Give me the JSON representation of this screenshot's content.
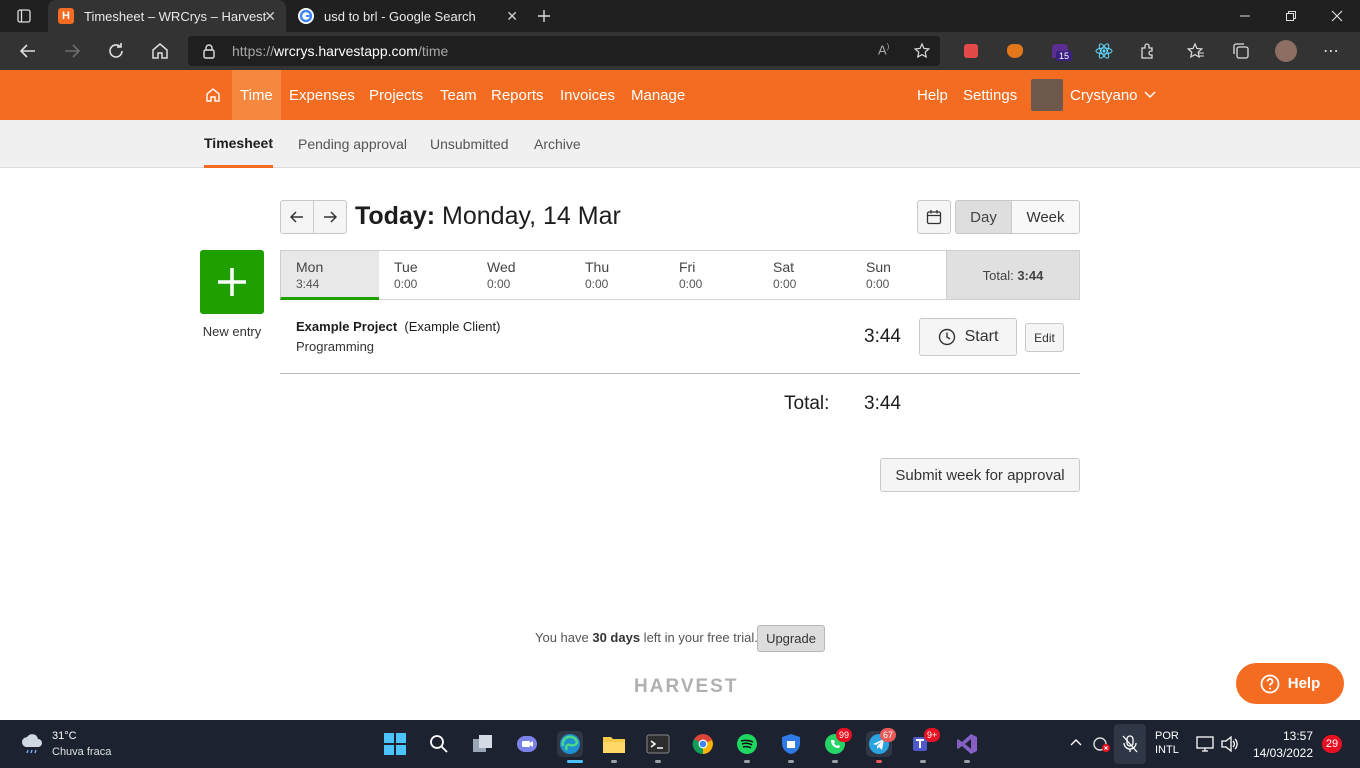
{
  "browser": {
    "tabs": [
      {
        "title": "Timesheet – WRCrys – Harvest",
        "favicon_letter": "H",
        "active": true
      },
      {
        "title": "usd to brl - Google Search",
        "favicon_letter": "G",
        "active": false
      }
    ],
    "url": {
      "scheme": "https://",
      "host": "wrcrys.harvestapp.com",
      "path": "/time"
    },
    "extension_badge": "15"
  },
  "nav": {
    "items": [
      "Time",
      "Expenses",
      "Projects",
      "Team",
      "Reports",
      "Invoices",
      "Manage"
    ],
    "active": "Time",
    "help": "Help",
    "settings": "Settings",
    "user": "Crystyano"
  },
  "subnav": {
    "items": [
      "Timesheet",
      "Pending approval",
      "Unsubmitted",
      "Archive"
    ],
    "active": "Timesheet"
  },
  "header": {
    "today_label": "Today:",
    "date_text": "Monday, 14 Mar"
  },
  "view_toggle": {
    "day": "Day",
    "week": "Week",
    "active": "Day"
  },
  "new_entry": {
    "label": "New entry"
  },
  "days": [
    {
      "name": "Mon",
      "time": "3:44",
      "active": true
    },
    {
      "name": "Tue",
      "time": "0:00"
    },
    {
      "name": "Wed",
      "time": "0:00"
    },
    {
      "name": "Thu",
      "time": "0:00"
    },
    {
      "name": "Fri",
      "time": "0:00"
    },
    {
      "name": "Sat",
      "time": "0:00"
    },
    {
      "name": "Sun",
      "time": "0:00"
    }
  ],
  "week_total": {
    "label": "Total:",
    "value": "3:44"
  },
  "entry": {
    "project": "Example Project",
    "client": "(Example Client)",
    "task": "Programming",
    "duration": "3:44",
    "start_label": "Start",
    "edit_label": "Edit"
  },
  "day_total": {
    "label": "Total:",
    "value": "3:44"
  },
  "submit_label": "Submit week for approval",
  "trial": {
    "prefix": "You have ",
    "days": "30 days",
    "suffix": " left in your free trial.",
    "upgrade": "Upgrade"
  },
  "footer_logo": "HARVEST",
  "help_button": "Help",
  "taskbar": {
    "weather_temp": "31°C",
    "weather_desc": "Chuva fraca",
    "badges": {
      "whatsapp": "99",
      "telegram": "67",
      "teams": "9+"
    },
    "lang_top": "POR",
    "lang_bottom": "INTL",
    "time": "13:57",
    "date": "14/03/2022",
    "notifications": "29"
  },
  "colors": {
    "brand_orange": "#f36c21",
    "new_entry_green": "#1fa000",
    "help_orange": "#f36c21"
  }
}
